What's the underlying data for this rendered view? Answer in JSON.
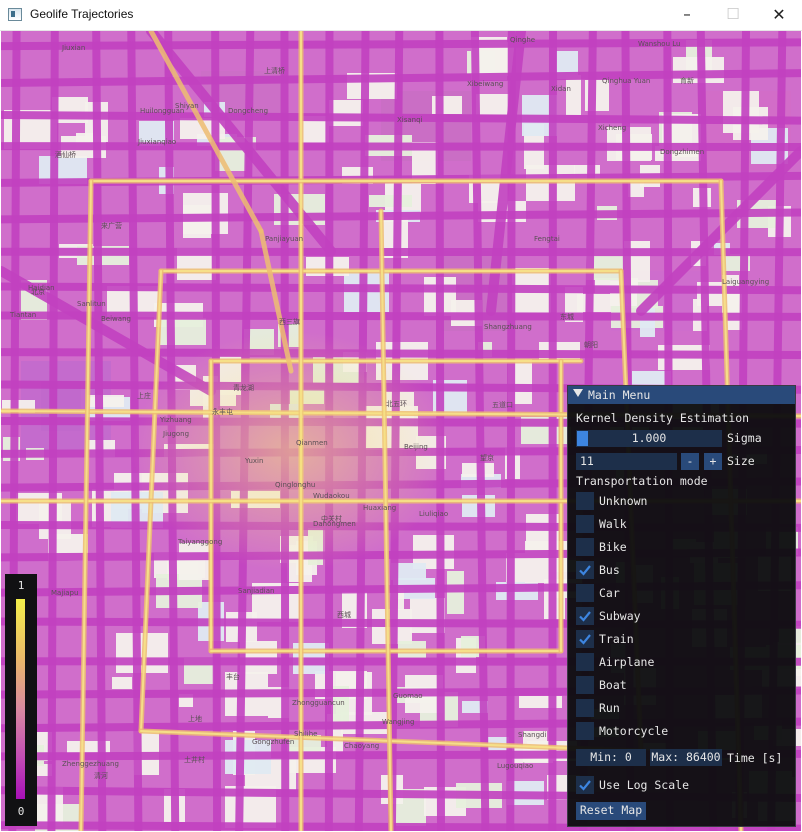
{
  "window": {
    "title": "Geolife Trajectories",
    "minimize_glyph": "–",
    "maximize_glyph": "☐",
    "close_glyph": "✕"
  },
  "map": {
    "place_labels": [
      "上庄",
      "上清桥",
      "Qinghe",
      "Shiyan",
      "清河",
      "永丰屯",
      "土井村",
      "Shangzhuang",
      "Beiwang",
      "Xibeiwang",
      "北五环",
      "Shangdi",
      "上地",
      "Xisanqi",
      "西三旗",
      "Huilongguan",
      "育新",
      "Yuxin",
      "Wudaokou",
      "五道口",
      "Qinghua Yuan",
      "Zhongguancun",
      "中关村",
      "Haidian",
      "Laiguangying",
      "来广营",
      "Wangjing",
      "望京",
      "Taiyanggong",
      "Sanlitun",
      "Jiuxianqiao",
      "酒仙桥",
      "Beijing",
      "北京",
      "Dongzhimen",
      "Chaoyang",
      "朝阳",
      "Guomao",
      "Dongcheng",
      "东城",
      "Xicheng",
      "西城",
      "Fengtai",
      "丰台",
      "Lugouqiao",
      "Wanshou Lu",
      "Gongzhufen",
      "Qinglonghu",
      "青龙湖",
      "Zhenggezhuang",
      "Liuliqiao",
      "Xidan",
      "Qianmen",
      "Tiantan",
      "Panjiayuan",
      "Shilihe",
      "Dahongmen",
      "Jiugong",
      "Majiapu",
      "Yizhuang",
      "Huaxiang",
      "Sanjiadian",
      "Jiuxian"
    ]
  },
  "colorbar": {
    "max_label": "1",
    "min_label": "0",
    "color_high": "#f3ef4a",
    "color_low": "#a810b8"
  },
  "menu": {
    "title": "Main Menu",
    "collapse_icon": "triangle-down",
    "kde_heading": "Kernel Density Estimation",
    "sigma_value": "1.000",
    "sigma_label": "Sigma",
    "size_value": "11",
    "size_minus": "-",
    "size_plus": "+",
    "size_label": "Size",
    "transport_heading": "Transportation mode",
    "modes": [
      {
        "label": "Unknown",
        "checked": false
      },
      {
        "label": "Walk",
        "checked": false
      },
      {
        "label": "Bike",
        "checked": false
      },
      {
        "label": "Bus",
        "checked": true
      },
      {
        "label": "Car",
        "checked": false
      },
      {
        "label": "Subway",
        "checked": true
      },
      {
        "label": "Train",
        "checked": true
      },
      {
        "label": "Airplane",
        "checked": false
      },
      {
        "label": "Boat",
        "checked": false
      },
      {
        "label": "Run",
        "checked": false
      },
      {
        "label": "Motorcycle",
        "checked": false
      }
    ],
    "time_min": "Min: 0",
    "time_max": "Max: 86400",
    "time_label": "Time [s]",
    "log_scale_label": "Use Log Scale",
    "log_scale_checked": true,
    "reset_label": "Reset Map",
    "accent": "#294a7a",
    "frame": "#1d2f4a",
    "slider_grab": "#3d85e0",
    "check_color": "#3d85e0"
  }
}
